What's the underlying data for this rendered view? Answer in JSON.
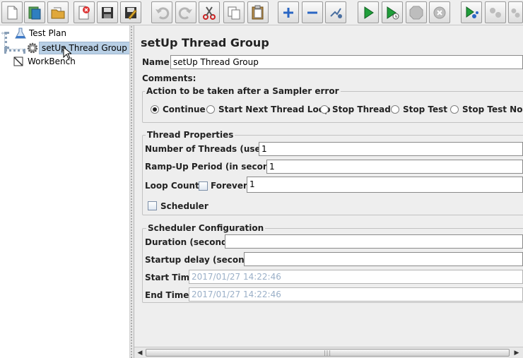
{
  "toolbar": {
    "buttons": [
      {
        "icon": "new-icon"
      },
      {
        "icon": "templates-icon"
      },
      {
        "icon": "open-icon"
      },
      {
        "icon": "close-file-icon"
      },
      {
        "icon": "save-icon"
      },
      {
        "icon": "save-as-icon"
      },
      {
        "icon": "undo-icon"
      },
      {
        "icon": "redo-icon"
      },
      {
        "icon": "cut-icon"
      },
      {
        "icon": "copy-icon"
      },
      {
        "icon": "paste-icon"
      },
      {
        "icon": "expand-icon"
      },
      {
        "icon": "collapse-icon"
      },
      {
        "icon": "toggle-icon"
      },
      {
        "icon": "start-icon"
      },
      {
        "icon": "start-no-pauses-icon"
      },
      {
        "icon": "stop-icon"
      },
      {
        "icon": "shutdown-icon"
      },
      {
        "icon": "remote-start-icon"
      },
      {
        "icon": "remote-stop-icon"
      },
      {
        "icon": "remote-shutdown-icon"
      }
    ]
  },
  "tree": {
    "test_plan": "Test Plan",
    "thread_group": "setUp Thread Group",
    "workbench": "WorkBench"
  },
  "main": {
    "title": "setUp Thread Group",
    "name_label": "Name:",
    "name_value": "setUp Thread Group",
    "comments_label": "Comments:",
    "sampler_error": {
      "legend": "Action to be taken after a Sampler error",
      "options": [
        "Continue",
        "Start Next Thread Loop",
        "Stop Thread",
        "Stop Test",
        "Stop Test Now"
      ],
      "selected": "Continue"
    },
    "thread_properties": {
      "legend": "Thread Properties",
      "threads_label": "Number of Threads (users):",
      "threads_value": "1",
      "rampup_label": "Ramp-Up Period (in seconds):",
      "rampup_value": "1",
      "loop_label": "Loop Count:",
      "forever_label": "Forever",
      "loop_value": "1",
      "scheduler_label": "Scheduler"
    },
    "scheduler_config": {
      "legend": "Scheduler Configuration",
      "duration_label": "Duration (seconds)",
      "duration_value": "",
      "startup_label": "Startup delay (seconds)",
      "startup_value": "",
      "start_time_label": "Start Time",
      "start_time_value": "2017/01/27 14:22:46",
      "end_time_label": "End Time",
      "end_time_value": "2017/01/27 14:22:46"
    }
  },
  "colors": {
    "accent_green": "#1f9e3a",
    "selection": "#b8cfe5",
    "disabled_text": "#9bb0c8"
  }
}
